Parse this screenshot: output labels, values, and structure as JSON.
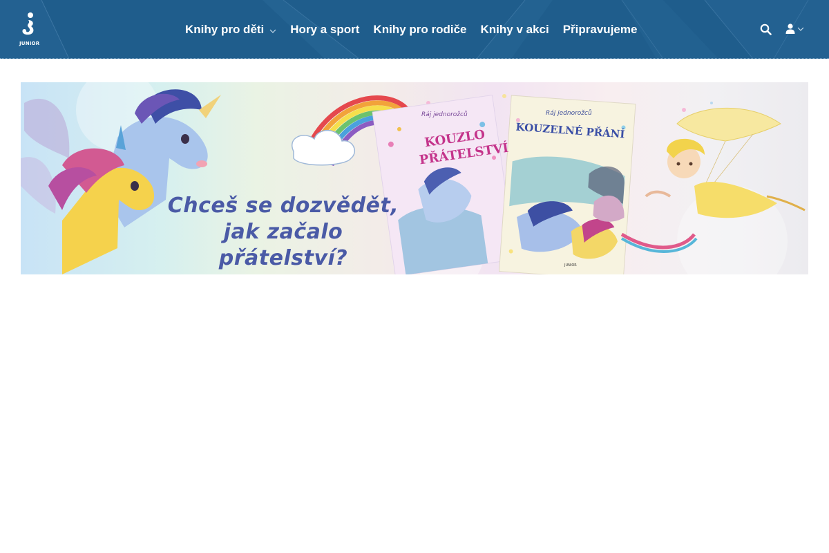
{
  "header": {
    "logo": {
      "text": "JUNIOR",
      "icon": "junior-logo-icon"
    },
    "nav": [
      {
        "label": "Knihy pro děti",
        "has_dropdown": true
      },
      {
        "label": "Hory a sport",
        "has_dropdown": false
      },
      {
        "label": "Knihy pro rodiče",
        "has_dropdown": false
      },
      {
        "label": "Knihy v akci",
        "has_dropdown": false
      },
      {
        "label": "Připravujeme",
        "has_dropdown": false
      }
    ],
    "tools": {
      "search_icon": "search-icon",
      "user_icon": "user-icon"
    },
    "colors": {
      "background": "#1f5d8c",
      "text": "#ffffff"
    }
  },
  "banner": {
    "headline_line1": "Chceš se dozvědět,",
    "headline_line2": "jak začalo přátelství?",
    "book1": {
      "series": "Ráj jednorožců",
      "title_line1": "KOUZLO",
      "title_line2": "PŘÁTELSTVÍ"
    },
    "book2": {
      "series": "Ráj jednorožců",
      "title": "KOUZELNÉ PŘÁNÍ",
      "publisher": "JUNIOR"
    },
    "colors": {
      "headline": "#4a5aa6"
    }
  }
}
